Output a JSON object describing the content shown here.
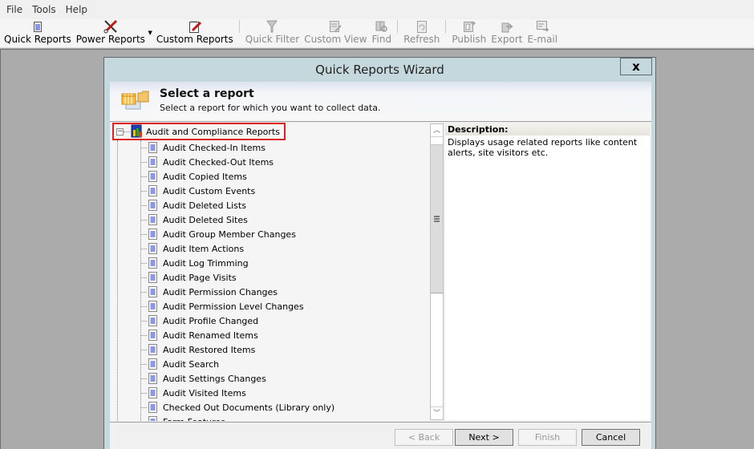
{
  "menubar": {
    "items": [
      "File",
      "Tools",
      "Help"
    ]
  },
  "toolbar": {
    "buttons": [
      {
        "label": "Quick Reports",
        "icon": "document-icon",
        "enabled": true
      },
      {
        "label": "Power Reports",
        "icon": "tools-icon",
        "enabled": true,
        "dropdown": true
      },
      {
        "label": "Custom Reports",
        "icon": "notepad-icon",
        "enabled": true
      },
      {
        "label": "Quick Filter",
        "icon": "filter-icon",
        "enabled": false
      },
      {
        "label": "Custom View",
        "icon": "custom-view-icon",
        "enabled": false
      },
      {
        "label": "Find",
        "icon": "find-icon",
        "enabled": false
      },
      {
        "label": "Refresh",
        "icon": "refresh-icon",
        "enabled": false
      },
      {
        "label": "Publish",
        "icon": "publish-icon",
        "enabled": false
      },
      {
        "label": "Export",
        "icon": "export-icon",
        "enabled": false
      },
      {
        "label": "E-mail",
        "icon": "email-icon",
        "enabled": false
      }
    ]
  },
  "dialog": {
    "title": "Quick Reports Wizard",
    "close_label": "x",
    "header": {
      "title": "Select a report",
      "subtitle": "Select a report for which you want to collect data."
    },
    "tree": {
      "root": {
        "label": "Audit and Compliance Reports",
        "expanded": true,
        "selected": true
      },
      "children": [
        "Audit Checked-In Items",
        "Audit Checked-Out Items",
        "Audit Copied Items",
        "Audit Custom Events",
        "Audit Deleted Lists",
        "Audit Deleted Sites",
        "Audit Group Member Changes",
        "Audit Item Actions",
        "Audit Log Trimming",
        "Audit Page Visits",
        "Audit Permission Changes",
        "Audit Permission Level Changes",
        "Audit Profile Changed",
        "Audit Renamed Items",
        "Audit Restored Items",
        "Audit Search",
        "Audit Settings Changes",
        "Audit Visited Items",
        "Checked Out Documents (Library only)",
        "Farm Features"
      ]
    },
    "description": {
      "heading": "Description:",
      "text": "Displays usage related reports like content alerts, site visitors etc."
    },
    "buttons": {
      "back": "< Back",
      "next": "Next >",
      "finish": "Finish",
      "cancel": "Cancel"
    }
  }
}
